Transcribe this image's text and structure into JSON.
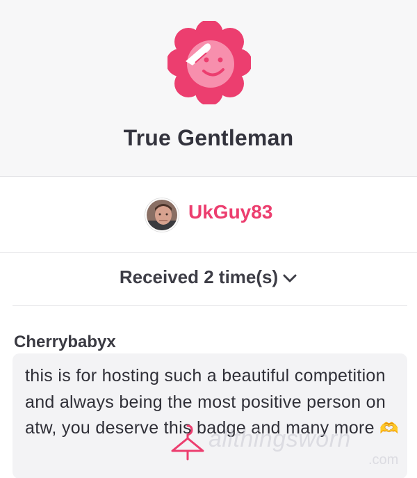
{
  "badge": {
    "title": "True Gentleman",
    "icon": "saluting-face-icon",
    "color": "#ec3e6f"
  },
  "user": {
    "username": "UkGuy83"
  },
  "received": {
    "label": "Received 2 time(s)"
  },
  "message": {
    "sender": "Cherrybabyx",
    "text": "this is for hosting such a beautiful competition and always being the most positive person on atw, you deserve this badge and many more",
    "emoji": "🫶"
  },
  "watermark": {
    "text": "allthingsworn",
    "suffix": ".com"
  }
}
